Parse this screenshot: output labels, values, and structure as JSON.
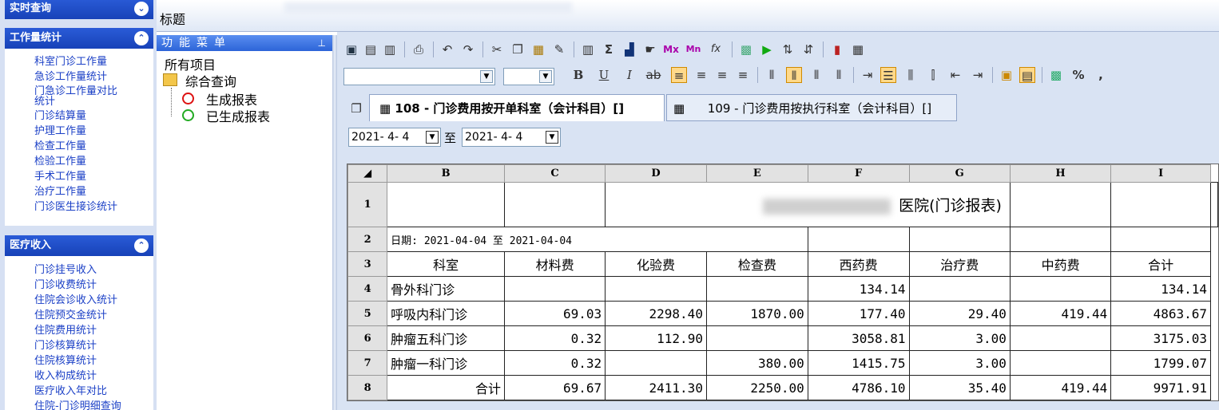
{
  "app": {
    "title": "标题"
  },
  "sidebar": {
    "sections": [
      {
        "title": "实时查询",
        "chevron": "double-down",
        "items": []
      },
      {
        "title": "工作量统计",
        "chevron": "double-up",
        "items": [
          "科室门诊工作量",
          "急诊工作量统计",
          "门急诊工作量对比统计",
          "门诊结算量",
          "护理工作量",
          "检查工作量",
          "检验工作量",
          "手术工作量",
          "治疗工作量",
          "门诊医生接诊统计"
        ]
      },
      {
        "title": "医疗收入",
        "chevron": "double-up",
        "items": [
          "门诊挂号收入",
          "门诊收费统计",
          "住院会诊收入统计",
          "住院预交金统计",
          "住院费用统计",
          "门诊核算统计",
          "住院核算统计",
          "收入构成统计",
          "医疗收入年对比",
          "住院-门诊明细查询"
        ]
      }
    ]
  },
  "function_menu": {
    "title": "功能菜单",
    "pin": "ꟼ",
    "tree": {
      "root": "所有项目",
      "group": "综合查询",
      "children": [
        "生成报表",
        "已生成报表"
      ]
    }
  },
  "toolbar": {
    "row1_icons": [
      "save-icon",
      "open-icon",
      "export-icon",
      "print-icon",
      "undo-icon",
      "redo-icon",
      "cut-icon",
      "copy-icon",
      "paste-icon",
      "format-painter-icon",
      "insert-column-icon",
      "sum-icon",
      "chart-wizard-icon",
      "hand-icon",
      "max-icon",
      "min-icon",
      "function-icon",
      "fill-icon",
      "run-icon",
      "sort-asc-icon",
      "sort-desc-icon",
      "bar-chart-icon",
      "calculator-icon"
    ],
    "sum_glyph": "Σ",
    "fx_glyph": "fx",
    "mx_label": "Mx",
    "mn_label": "Mn",
    "bold": "B",
    "underline": "U",
    "italic": "I",
    "percent": "%",
    "comma": ","
  },
  "tabs": [
    {
      "label": "108 - 门诊费用按开单科室（会计科目）[]",
      "active": true
    },
    {
      "label": "109 - 门诊费用按执行科室（会计科目）[]",
      "active": false
    }
  ],
  "date_filter": {
    "from": "2021- 4- 4",
    "separator": "至",
    "to": "2021- 4- 4"
  },
  "sheet": {
    "columns": [
      "B",
      "C",
      "D",
      "E",
      "F",
      "G",
      "H",
      "I"
    ],
    "row_numbers": [
      "1",
      "2",
      "3",
      "4",
      "5",
      "6",
      "7",
      "8"
    ],
    "report_title": "医院(门诊报表)",
    "date_line": "日期: 2021-04-04 至 2021-04-04",
    "headers": [
      "科室",
      "材料费",
      "化验费",
      "检查费",
      "西药费",
      "治疗费",
      "中药费",
      "合计"
    ],
    "rows": [
      [
        "骨外科门诊",
        "",
        "",
        "",
        "134.14",
        "",
        "",
        "134.14"
      ],
      [
        "呼吸内科门诊",
        "69.03",
        "2298.40",
        "1870.00",
        "177.40",
        "29.40",
        "419.44",
        "4863.67"
      ],
      [
        "肿瘤五科门诊",
        "0.32",
        "112.90",
        "",
        "3058.81",
        "3.00",
        "",
        "3175.03"
      ],
      [
        "肿瘤一科门诊",
        "0.32",
        "",
        "380.00",
        "1415.75",
        "3.00",
        "",
        "1799.07"
      ]
    ],
    "total_row": [
      "合计",
      "69.67",
      "2411.30",
      "2250.00",
      "4786.10",
      "35.40",
      "419.44",
      "9971.91"
    ]
  }
}
